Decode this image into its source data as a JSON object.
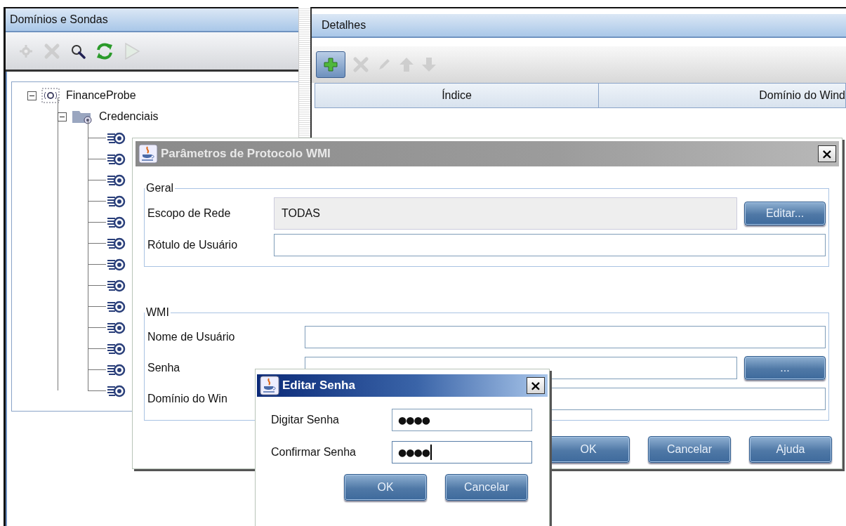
{
  "left_panel": {
    "title": "Domínios e Sondas",
    "toolbar": [
      {
        "kind": "gear",
        "disabled": true
      },
      {
        "kind": "delete",
        "disabled": true
      },
      {
        "kind": "search",
        "disabled": false
      },
      {
        "kind": "refresh",
        "disabled": false
      },
      {
        "kind": "play",
        "disabled": true
      }
    ],
    "tree": [
      {
        "label": "FinanceProbe",
        "kind": "probe",
        "expanded": true,
        "children": [
          {
            "label": "Credenciais",
            "kind": "folder",
            "expanded": true,
            "children": [
              {
                "kind": "protocol"
              },
              {
                "kind": "protocol"
              },
              {
                "kind": "protocol"
              },
              {
                "kind": "protocol"
              },
              {
                "kind": "protocol"
              },
              {
                "kind": "protocol"
              },
              {
                "kind": "protocol"
              },
              {
                "kind": "protocol"
              },
              {
                "kind": "protocol"
              },
              {
                "kind": "protocol"
              },
              {
                "kind": "protocol"
              },
              {
                "kind": "protocol"
              },
              {
                "kind": "protocol"
              }
            ]
          }
        ]
      }
    ]
  },
  "right_panel": {
    "title": "Detalhes",
    "toolbar": [
      {
        "kind": "add",
        "disabled": false
      },
      {
        "kind": "delete",
        "disabled": true
      },
      {
        "kind": "edit",
        "disabled": true
      },
      {
        "kind": "up",
        "disabled": true
      },
      {
        "kind": "down",
        "disabled": true
      }
    ],
    "table": {
      "columns": [
        "Índice",
        "Domínio do Wind"
      ]
    }
  },
  "protocol_dialog": {
    "title": "Parâmetros de Protocolo WMI",
    "close": "×",
    "groups": [
      {
        "title": "Geral",
        "rows": [
          {
            "label": "Escopo de Rede",
            "kind": "readonly",
            "value": "TODAS",
            "button": "Editar..."
          },
          {
            "label": "Rótulo de Usuário",
            "kind": "text"
          }
        ]
      },
      {
        "title": "WMI",
        "rows": [
          {
            "label": "Nome de Usuário",
            "kind": "text"
          },
          {
            "label": "Senha",
            "kind": "password",
            "button": "..."
          },
          {
            "label": "Domínio do Win",
            "kind": "text"
          }
        ]
      }
    ],
    "buttons": [
      "OK",
      "Cancelar",
      "Ajuda"
    ]
  },
  "password_dialog": {
    "title": "Editar Senha",
    "close": "×",
    "fields": [
      {
        "label": "Digitar Senha",
        "value": "●●●●",
        "focused": false
      },
      {
        "label": "Confirmar Senha",
        "value": "●●●●",
        "focused": true
      }
    ],
    "buttons": [
      "OK",
      "Cancelar"
    ]
  }
}
